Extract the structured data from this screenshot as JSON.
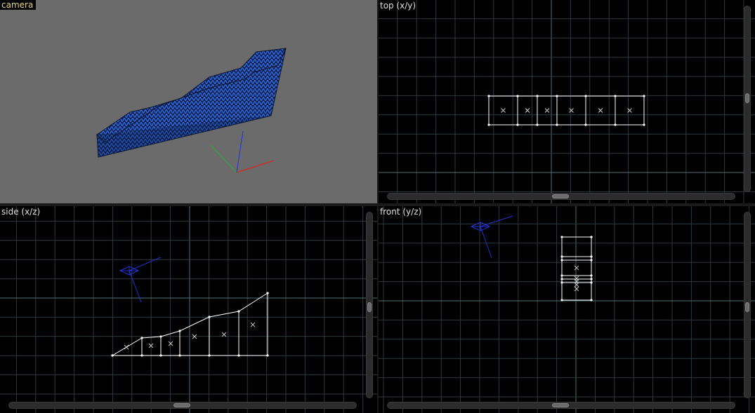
{
  "viewports": {
    "camera": {
      "label": "camera"
    },
    "top": {
      "label": "top (x/y)"
    },
    "side": {
      "label": "side (x/z)"
    },
    "front": {
      "label": "front (y/z)"
    }
  },
  "colors": {
    "camera_bg": "#6b6b6b",
    "ortho_bg": "#000000",
    "grid_minor": "#2e3a3e",
    "grid_major": "#4f7276",
    "mesh_blue": "#1e4fa8",
    "wire": "#ffffff",
    "camera_gizmo": "#1f33d6",
    "axis_x": "#d42a2a",
    "axis_y": "#2aa83a",
    "axis_z": "#2a3ad4",
    "active_label": "#e8d86a"
  }
}
